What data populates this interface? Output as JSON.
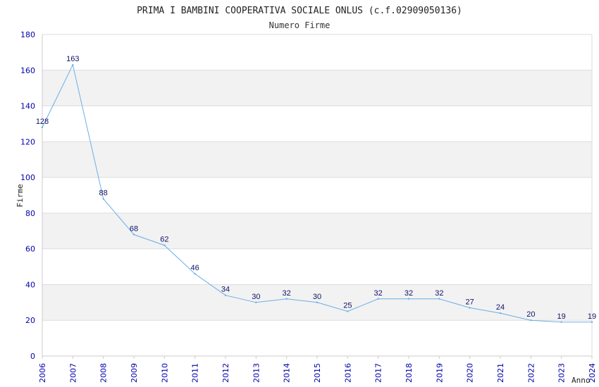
{
  "chart_data": {
    "type": "line",
    "title": "PRIMA I BAMBINI COOPERATIVA SOCIALE ONLUS (c.f.02909050136)",
    "subtitle": "Numero Firme",
    "xlabel": "Anno",
    "ylabel": "Firme",
    "x": [
      "2006",
      "2007",
      "2008",
      "2009",
      "2010",
      "2011",
      "2012",
      "2013",
      "2014",
      "2015",
      "2016",
      "2017",
      "2018",
      "2019",
      "2020",
      "2021",
      "2022",
      "2023",
      "2024"
    ],
    "yticks": [
      "0",
      "20",
      "40",
      "60",
      "80",
      "100",
      "120",
      "140",
      "160",
      "180"
    ],
    "series": [
      {
        "values": [
          128,
          163,
          88,
          68,
          62,
          46,
          34,
          30,
          32,
          30,
          25,
          32,
          32,
          32,
          27,
          24,
          20,
          19,
          19
        ]
      }
    ],
    "data_labels": [
      "128",
      "163",
      "88",
      "68",
      "62",
      "46",
      "34",
      "30",
      "32",
      "30",
      "25",
      "32",
      "32",
      "32",
      "27",
      "24",
      "20",
      "19",
      "19"
    ],
    "ylim": [
      0,
      180
    ],
    "grid": true,
    "line_color": "#6aaee8",
    "band_color": "#f2f2f2",
    "tick_color": "#0000aa"
  }
}
